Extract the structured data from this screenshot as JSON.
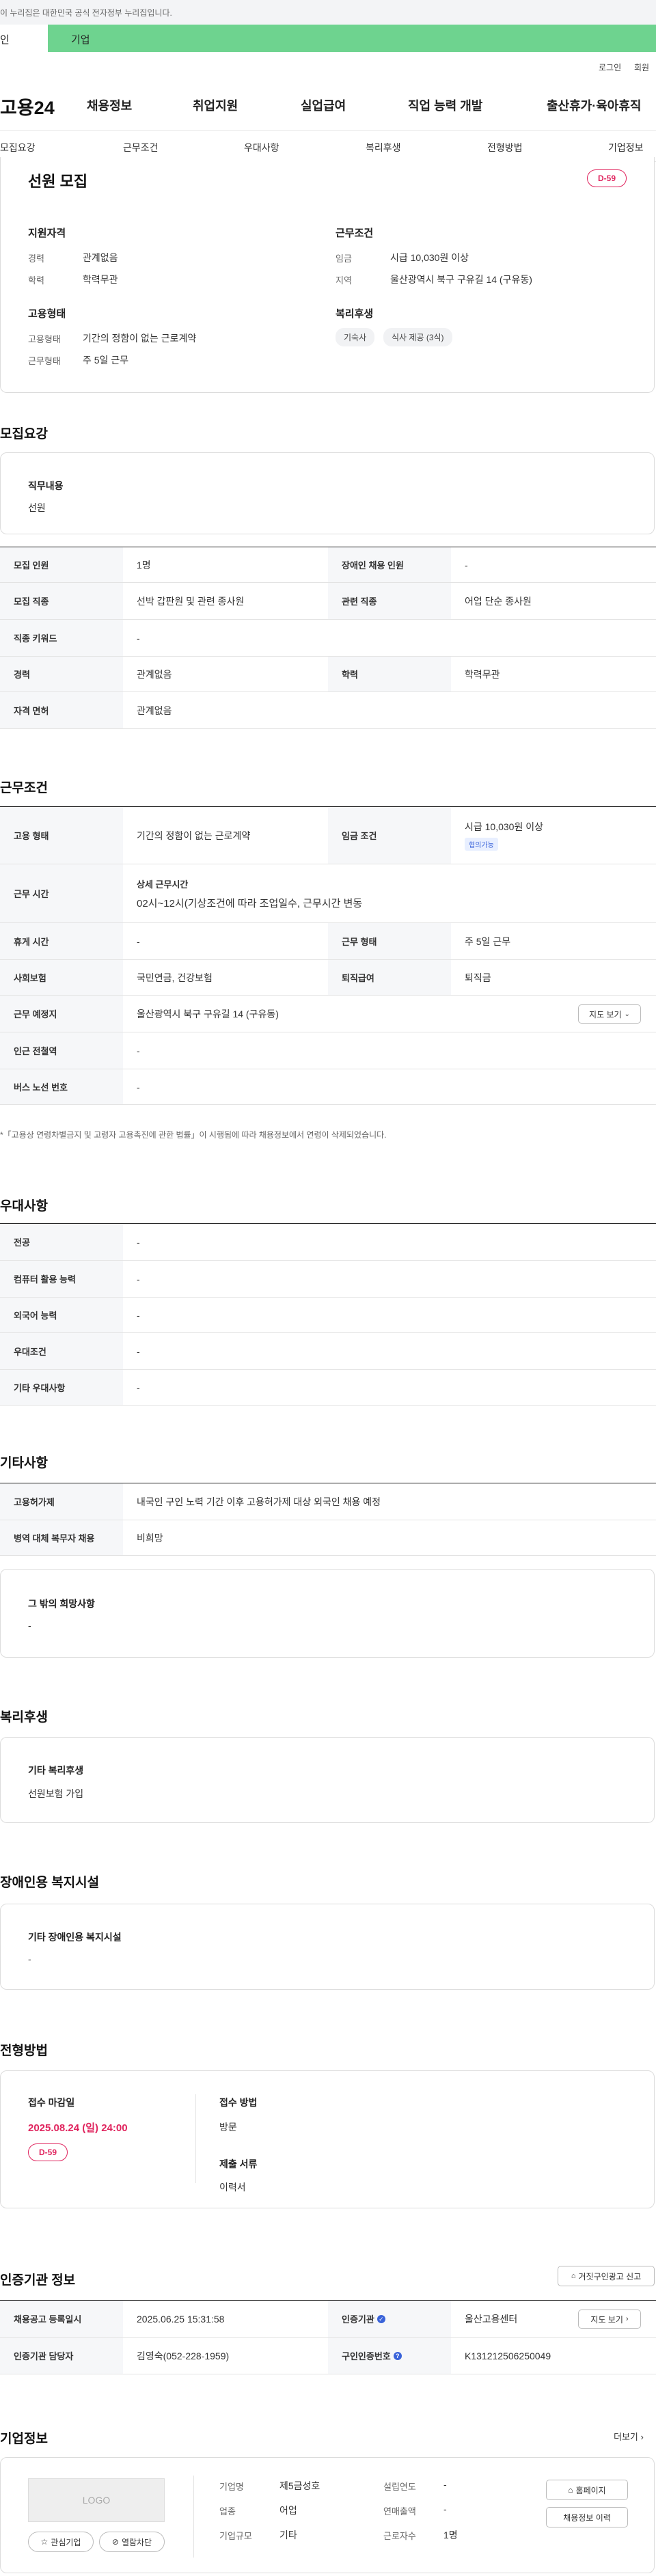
{
  "gov_notice": "이 누리집은 대한민국 공식 전자정부 누리집입니다.",
  "tabs": {
    "first": "인",
    "second": "기업"
  },
  "util": {
    "login": "로그인",
    "join": "회원"
  },
  "logo": "고용24",
  "gnb": [
    "채용정보",
    "취업지원",
    "실업급여",
    "직업 능력 개발",
    "출산휴가·육아휴직"
  ],
  "snb": [
    "모집요강",
    "근무조건",
    "우대사항",
    "복리후생",
    "전형방법",
    "기업정보"
  ],
  "summary": {
    "title": "선원 모집",
    "dday": "D-59",
    "qual_h": "지원자격",
    "qual": [
      {
        "label": "경력",
        "value": "관계없음"
      },
      {
        "label": "학력",
        "value": "학력무관"
      }
    ],
    "cond_h": "근무조건",
    "cond": [
      {
        "label": "임금",
        "value": "시급 10,030원 이상"
      },
      {
        "label": "지역",
        "value": "울산광역시 북구 구유길 14 (구유동)"
      }
    ],
    "emp_h": "고용형태",
    "emp": [
      {
        "label": "고용형태",
        "value": "기간의 정함이 없는 근로계약"
      },
      {
        "label": "근무형태",
        "value": "주 5일 근무"
      }
    ],
    "welfare_h": "복리후생",
    "welfare_chips": [
      "기숙사",
      "식사 제공 (3식)"
    ]
  },
  "recruit": {
    "title": "모집요강",
    "duty_h": "직무내용",
    "duty": "선원",
    "rows": [
      {
        "k1": "모집 인원",
        "v1": "1명",
        "k2": "장애인 채용 인원",
        "v2": "-"
      },
      {
        "k1": "모집 직종",
        "v1": "선박 갑판원 및 관련 종사원",
        "k2": "관련 직종",
        "v2": "어업 단순 종사원"
      },
      {
        "k1": "직종 키워드",
        "v1": "-"
      },
      {
        "k1": "경력",
        "v1": "관계없음",
        "k2": "학력",
        "v2": "학력무관"
      },
      {
        "k1": "자격 면허",
        "v1": "관계없음"
      }
    ]
  },
  "work": {
    "title": "근무조건",
    "emp_type_k": "고용 형태",
    "emp_type_v": "기간의 정함이 없는 근로계약",
    "wage_k": "임금 조건",
    "wage_v": "시급 10,030원 이상",
    "wage_tag": "협의가능",
    "hours_k": "근무 시간",
    "hours_sub": "상세 근무시간",
    "hours_v": "02시~12시(기상조건에 따라 조업일수, 근무시간 변동",
    "rest_k": "휴게 시간",
    "rest_v": "-",
    "form_k": "근무 형태",
    "form_v": "주 5일 근무",
    "ins_k": "사회보험",
    "ins_v": "국민연금, 건강보험",
    "ret_k": "퇴직급여",
    "ret_v": "퇴직금",
    "place_k": "근무 예정지",
    "place_v": "울산광역시 북구 구유길 14 (구유동)",
    "map_btn": "지도 보기",
    "station_k": "인근 전철역",
    "station_v": "-",
    "bus_k": "버스 노선 번호",
    "bus_v": "-",
    "note": "*「고용상 연령차별금지 및 고령자 고용촉진에 관한 법률」이 시행됨에 따라 채용정보에서 연령이 삭제되었습니다."
  },
  "pref": {
    "title": "우대사항",
    "rows": [
      {
        "k": "전공",
        "v": "-"
      },
      {
        "k": "컴퓨터 활용 능력",
        "v": "-"
      },
      {
        "k": "외국어 능력",
        "v": "-"
      },
      {
        "k": "우대조건",
        "v": "-"
      },
      {
        "k": "기타 우대사항",
        "v": "-"
      }
    ]
  },
  "etc": {
    "title": "기타사항",
    "rows": [
      {
        "k": "고용허가제",
        "v": "내국인 구인 노력 기간 이후 고용허가제 대상 외국인 채용 예정"
      },
      {
        "k": "병역 대체 복무자 채용",
        "v": "비희망"
      }
    ],
    "box_h": "그 밖의 희망사항",
    "box_v": "-"
  },
  "welfare": {
    "title": "복리후생",
    "box_h": "기타 복리후생",
    "box_v": "선원보험 가입"
  },
  "disabled": {
    "title": "장애인용 복지시설",
    "box_h": "기타 장애인용 복지시설",
    "box_v": "-"
  },
  "process": {
    "title": "전형방법",
    "deadline_h": "접수 마감일",
    "deadline": "2025.08.24 (일) 24:00",
    "dday": "D-59",
    "method_h": "접수 방법",
    "method": "방문",
    "docs_h": "제출 서류",
    "docs": "이력서"
  },
  "agency": {
    "title": "인증기관 정보",
    "report_btn": "거짓구인광고 신고",
    "reg_k": "채용공고 등록일시",
    "reg_v": "2025.06.25 15:31:58",
    "org_k": "인증기관",
    "org_v": "울산고용센터",
    "map_btn": "지도 보기",
    "mgr_k": "인증기관 담당자",
    "mgr_v": "김영숙(052-228-1959)",
    "num_k": "구인인증번호",
    "num_v": "K131212506250049"
  },
  "company": {
    "title": "기업정보",
    "more": "더보기",
    "logo": "LOGO",
    "fav_btn": "관심기업",
    "block_btn": "열람차단",
    "name_k": "기업명",
    "name_v": "제5금성호",
    "ind_k": "업종",
    "ind_v": "어업",
    "size_k": "기업규모",
    "size_v": "기타",
    "year_k": "설립연도",
    "year_v": "-",
    "sales_k": "연매출액",
    "sales_v": "-",
    "emp_k": "근로자수",
    "emp_v": "1명",
    "home_btn": "홈페이지",
    "hist_btn": "채용정보 이력"
  },
  "colors": {
    "green": "#6ed38f",
    "red": "#e0245e",
    "blue": "#3a63d9"
  }
}
